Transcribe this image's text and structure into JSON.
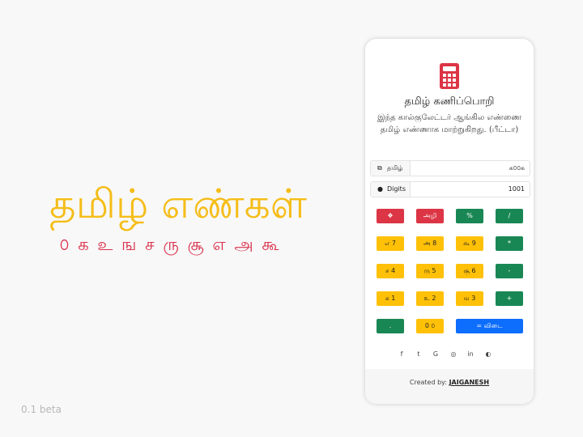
{
  "hero": {
    "title": "தமிழ் எண்கள்",
    "digits": "௦ க உ ங ச ரு சூ எ அ கூ"
  },
  "version": "0.1 beta",
  "app": {
    "icon": "calculator-icon",
    "title": "தமிழ் கணிப்பொறி",
    "description": "இந்த கால்குலேட்டர் ஆங்கில எண்ணை தமிழ் எண்ணாக மாற்றுகிறது. (பீட்டா)",
    "tamil_field": {
      "icon": "translate-icon",
      "label": "தமிழ்",
      "value": "க௦௦க"
    },
    "digits_field": {
      "icon": "circle-icon",
      "label": "Digits",
      "value": "1001"
    },
    "buttons": [
      [
        {
          "label": "❖",
          "color": "red",
          "name": "clear-button"
        },
        {
          "label": "அழி",
          "color": "red",
          "name": "delete-button"
        },
        {
          "label": "%",
          "color": "green",
          "name": "percent-button"
        },
        {
          "label": "/",
          "color": "green",
          "name": "divide-button"
        }
      ],
      [
        {
          "label": "எ 7",
          "color": "yellow",
          "name": "seven-button"
        },
        {
          "label": "அ 8",
          "color": "yellow",
          "name": "eight-button"
        },
        {
          "label": "கூ 9",
          "color": "yellow",
          "name": "nine-button"
        },
        {
          "label": "*",
          "color": "green",
          "name": "multiply-button"
        }
      ],
      [
        {
          "label": "ச 4",
          "color": "yellow",
          "name": "four-button"
        },
        {
          "label": "ரு 5",
          "color": "yellow",
          "name": "five-button"
        },
        {
          "label": "சூ 6",
          "color": "yellow",
          "name": "six-button"
        },
        {
          "label": "-",
          "color": "green",
          "name": "minus-button"
        }
      ],
      [
        {
          "label": "க 1",
          "color": "yellow",
          "name": "one-button"
        },
        {
          "label": "உ 2",
          "color": "yellow",
          "name": "two-button"
        },
        {
          "label": "ங 3",
          "color": "yellow",
          "name": "three-button"
        },
        {
          "label": "+",
          "color": "green",
          "name": "plus-button"
        }
      ],
      [
        {
          "label": ".",
          "color": "green",
          "name": "decimal-button"
        },
        {
          "label": "0 ௦",
          "color": "yellow",
          "name": "zero-button"
        },
        {
          "label": "= விடை",
          "color": "blue",
          "name": "equals-button"
        }
      ]
    ],
    "social": [
      "facebook-icon",
      "twitter-icon",
      "google-icon",
      "instagram-icon",
      "linkedin-icon",
      "github-icon"
    ],
    "footer": {
      "prefix": "Created by:",
      "author": "JAIGANESH"
    }
  }
}
